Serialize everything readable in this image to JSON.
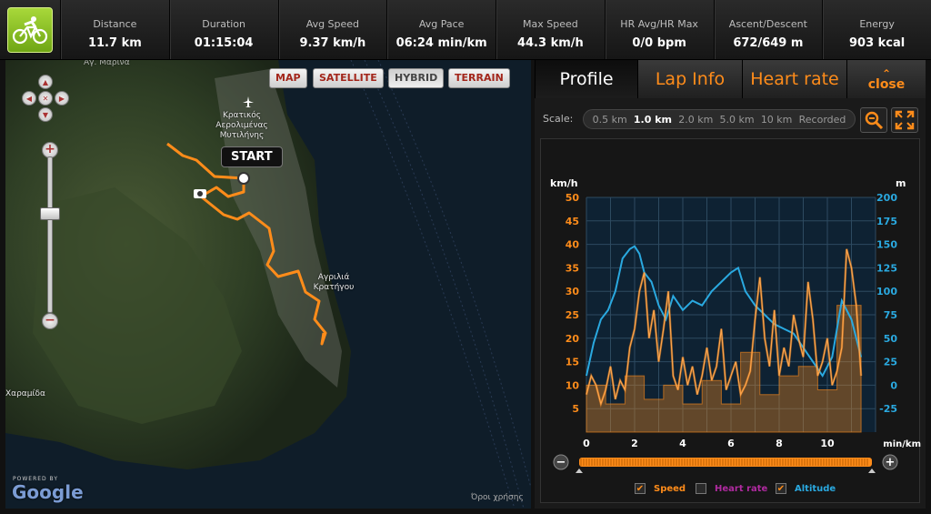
{
  "stats": [
    {
      "label": "Distance",
      "value": "11.7 km"
    },
    {
      "label": "Duration",
      "value": "01:15:04"
    },
    {
      "label": "Avg Speed",
      "value": "9.37 km/h"
    },
    {
      "label": "Avg Pace",
      "value": "06:24 min/km"
    },
    {
      "label": "Max Speed",
      "value": "44.3 km/h"
    },
    {
      "label": "HR Avg/HR Max",
      "value": "0/0 bpm"
    },
    {
      "label": "Ascent/Descent",
      "value": "672/649 m"
    },
    {
      "label": "Energy",
      "value": "903 kcal"
    }
  ],
  "sport_icon": "cyclist-icon",
  "map": {
    "types": [
      "MAP",
      "SATELLITE",
      "HYBRID",
      "TERRAIN"
    ],
    "active_type": "HYBRID",
    "start_label": "START",
    "places": {
      "airport": "Κρατικός Αερολιμένας Μυτιλήνης",
      "village": "Αγριλιά Κρατήγου",
      "west": "Χαραμίδα",
      "north": "Αγ. Μαρίνα"
    },
    "powered_by": "POWERED BY",
    "brand": "Google",
    "terms": "Όροι χρήσης"
  },
  "tabs": {
    "profile": "Profile",
    "lap_info": "Lap Info",
    "heart_rate": "Heart rate",
    "close": "close"
  },
  "scale": {
    "label": "Scale:",
    "options": [
      "0.5 km",
      "1.0 km",
      "2.0 km",
      "5.0 km",
      "10 km",
      "Recorded"
    ],
    "selected": "1.0 km"
  },
  "legend": {
    "speed": "Speed",
    "heart_rate": "Heart rate",
    "altitude": "Altitude"
  },
  "colors": {
    "accent": "#ff8c1a",
    "speed": "#ff8c1a",
    "altitude": "#2aa9e0",
    "heart_rate": "#b02aa0"
  },
  "chart_data": {
    "type": "line",
    "x_unit": "min/km",
    "x_ticks": [
      0,
      2,
      4,
      6,
      8,
      10
    ],
    "x_range": [
      0,
      12
    ],
    "y_left": {
      "unit": "km/h",
      "ticks": [
        5,
        10,
        15,
        20,
        25,
        30,
        35,
        40,
        45,
        50
      ],
      "range": [
        0,
        50
      ]
    },
    "y_right": {
      "unit": "m",
      "ticks": [
        -25,
        0,
        25,
        50,
        75,
        100,
        125,
        150,
        175,
        200
      ],
      "range": [
        -50,
        200
      ]
    },
    "series": [
      {
        "name": "Speed",
        "x": [
          0,
          0.2,
          0.4,
          0.6,
          0.8,
          1.0,
          1.2,
          1.4,
          1.6,
          1.8,
          2.0,
          2.2,
          2.4,
          2.6,
          2.8,
          3.0,
          3.2,
          3.4,
          3.6,
          3.8,
          4.0,
          4.2,
          4.4,
          4.6,
          4.8,
          5.0,
          5.2,
          5.4,
          5.6,
          5.8,
          6.0,
          6.2,
          6.4,
          6.6,
          6.8,
          7.0,
          7.2,
          7.4,
          7.6,
          7.8,
          8.0,
          8.2,
          8.4,
          8.6,
          8.8,
          9.0,
          9.2,
          9.4,
          9.6,
          9.8,
          10.0,
          10.2,
          10.4,
          10.6,
          10.8,
          11.0,
          11.2,
          11.4
        ],
        "values": [
          8,
          12,
          10,
          6,
          9,
          14,
          7,
          11,
          9,
          18,
          22,
          30,
          34,
          20,
          26,
          15,
          22,
          30,
          12,
          9,
          16,
          10,
          14,
          8,
          12,
          18,
          11,
          14,
          22,
          9,
          12,
          15,
          8,
          10,
          13,
          24,
          33,
          20,
          14,
          26,
          12,
          18,
          14,
          25,
          20,
          16,
          32,
          24,
          12,
          15,
          20,
          10,
          13,
          18,
          39,
          35,
          27,
          12
        ]
      },
      {
        "name": "Speed",
        "x": [
          0,
          0.8,
          0.8,
          1.6,
          1.6,
          2.4,
          2.4,
          3.2,
          3.2,
          4.0,
          4.0,
          4.8,
          4.8,
          5.6,
          5.6,
          6.4,
          6.4,
          7.2,
          7.2,
          8.0,
          8.0,
          8.8,
          8.8,
          9.6,
          9.6,
          10.4,
          10.4,
          11.4
        ],
        "values": [
          10,
          10,
          6,
          6,
          12,
          12,
          7,
          7,
          10,
          10,
          6,
          6,
          11,
          11,
          6,
          6,
          17,
          17,
          8,
          8,
          12,
          12,
          14,
          14,
          9,
          9,
          27,
          27
        ]
      },
      {
        "name": "Altitude",
        "x": [
          0,
          0.3,
          0.6,
          0.9,
          1.2,
          1.5,
          1.8,
          2.0,
          2.2,
          2.4,
          2.7,
          3.0,
          3.3,
          3.6,
          4.0,
          4.4,
          4.8,
          5.2,
          5.6,
          6.0,
          6.3,
          6.6,
          7.0,
          7.4,
          7.8,
          8.2,
          8.6,
          9.0,
          9.4,
          9.8,
          10.2,
          10.6,
          11.0,
          11.4
        ],
        "values": [
          10,
          45,
          70,
          80,
          100,
          135,
          145,
          148,
          140,
          120,
          110,
          85,
          70,
          95,
          80,
          90,
          85,
          100,
          110,
          120,
          125,
          100,
          85,
          75,
          65,
          60,
          55,
          40,
          25,
          10,
          30,
          90,
          70,
          30
        ]
      }
    ]
  }
}
